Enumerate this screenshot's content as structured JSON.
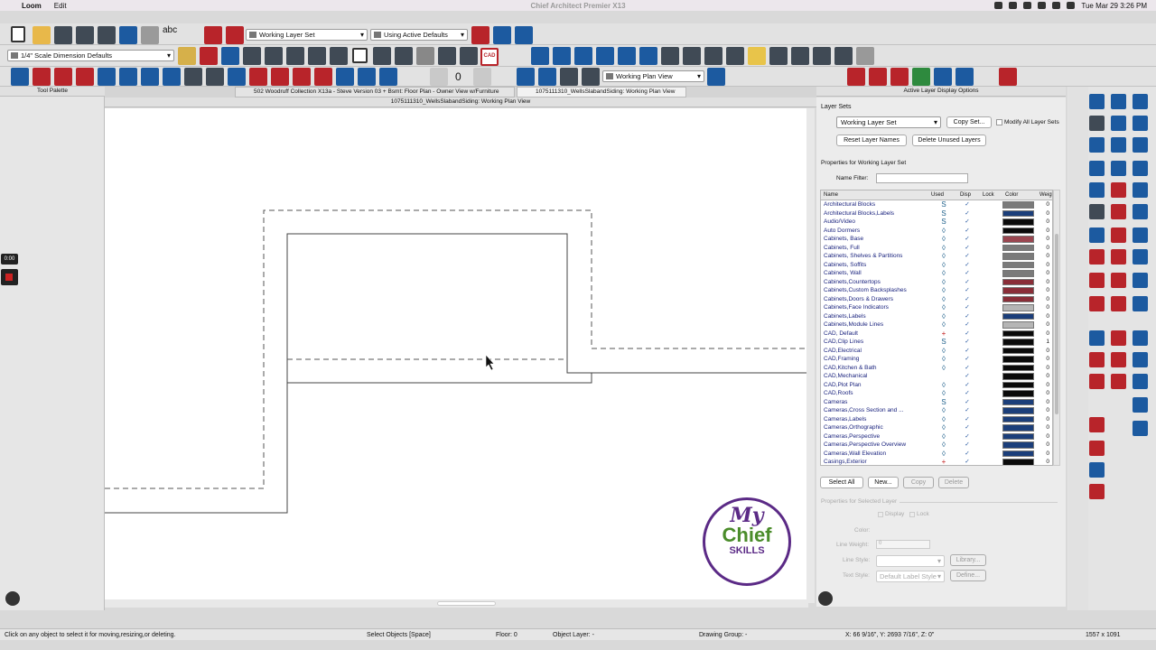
{
  "mac_menu": {
    "app": "Loom",
    "edit": "Edit",
    "window_title": "Chief Architect Premier X13",
    "datetime": "Tue Mar 29  3:26 PM"
  },
  "toolbar1": {
    "layer_set": "Working Layer Set",
    "defaults": "Using Active Defaults",
    "abc": "abc"
  },
  "toolbar2": {
    "dimension_defaults": "1/4\" Scale Dimension Defaults",
    "cad_label": "CAD"
  },
  "toolbar3": {
    "counter": "0",
    "plan_view": "Working Plan View"
  },
  "tabs": {
    "tool_palette": "Tool Palette",
    "tab1": "502 Woodruff Collection X13a - Steve Version 03 + Bsmt: Floor Plan - Owner View w/Furniture",
    "tab2": "1075111310_WellsSlabandSiding:  Working Plan View",
    "doc_title": "1075111310_WellsSlabandSiding:  Working Plan View",
    "ldp_title": "Active Layer Display Options"
  },
  "recorder": {
    "time": "0:00"
  },
  "ldp": {
    "layer_sets_label": "Layer Sets",
    "layer_set_value": "Working Layer Set",
    "copy_set": "Copy Set...",
    "modify_all": "Modify All Layer Sets",
    "reset_names": "Reset Layer Names",
    "delete_unused": "Delete Unused Layers",
    "properties_for": "Properties for  Working Layer Set",
    "name_filter": "Name Filter:",
    "cols": {
      "name": "Name",
      "used": "Used",
      "disp": "Disp",
      "lock": "Lock",
      "color": "Color",
      "weight": "Weigh"
    },
    "layers": [
      {
        "name": "Architectural Blocks",
        "used": "S",
        "color": "#7a7a7a",
        "weight": "0"
      },
      {
        "name": "Architectural Blocks,Labels",
        "used": "S",
        "color": "#1b3e7a",
        "weight": "0"
      },
      {
        "name": "Audio/Video",
        "used": "S",
        "color": "#0a0a0a",
        "weight": "0"
      },
      {
        "name": "Auto Dormers",
        "used": "◊",
        "color": "#0a0a0a",
        "weight": "0"
      },
      {
        "name": "Cabinets, Base",
        "used": "◊",
        "color": "#9a4650",
        "weight": "0"
      },
      {
        "name": "Cabinets, Full",
        "used": "◊",
        "color": "#7a7a7a",
        "weight": "0"
      },
      {
        "name": "Cabinets, Shelves & Partitions",
        "used": "◊",
        "color": "#7a7a7a",
        "weight": "0"
      },
      {
        "name": "Cabinets, Soffits",
        "used": "◊",
        "color": "#7a7a7a",
        "weight": "0"
      },
      {
        "name": "Cabinets, Wall",
        "used": "◊",
        "color": "#7a7a7a",
        "weight": "0"
      },
      {
        "name": "Cabinets,Countertops",
        "used": "◊",
        "color": "#8a2e38",
        "weight": "0"
      },
      {
        "name": "Cabinets,Custom Backsplashes",
        "used": "◊",
        "color": "#8a2e38",
        "weight": "0"
      },
      {
        "name": "Cabinets,Doors & Drawers",
        "used": "◊",
        "color": "#8a2e38",
        "weight": "0"
      },
      {
        "name": "Cabinets,Face Indicators",
        "used": "◊",
        "color": "#b5b5b5",
        "weight": "0"
      },
      {
        "name": "Cabinets,Labels",
        "used": "◊",
        "color": "#1b3e7a",
        "weight": "0"
      },
      {
        "name": "Cabinets,Module Lines",
        "used": "◊",
        "color": "#b5b5b5",
        "weight": "0"
      },
      {
        "name": "CAD, Default",
        "used": "+",
        "color": "#0a0a0a",
        "weight": "0"
      },
      {
        "name": "CAD,Clip Lines",
        "used": "S",
        "color": "#0a0a0a",
        "weight": "1"
      },
      {
        "name": "CAD,Electrical",
        "used": "◊",
        "color": "#0a0a0a",
        "weight": "0"
      },
      {
        "name": "CAD,Framing",
        "used": "◊",
        "color": "#0a0a0a",
        "weight": "0"
      },
      {
        "name": "CAD,Kitchen & Bath",
        "used": "◊",
        "color": "#0a0a0a",
        "weight": "0"
      },
      {
        "name": "CAD,Mechanical",
        "used": "",
        "color": "#0a0a0a",
        "weight": "0"
      },
      {
        "name": "CAD,Plot Plan",
        "used": "◊",
        "color": "#0a0a0a",
        "weight": "0"
      },
      {
        "name": "CAD,Roofs",
        "used": "◊",
        "color": "#0a0a0a",
        "weight": "0"
      },
      {
        "name": "Cameras",
        "used": "S",
        "color": "#1b3e7a",
        "weight": "0"
      },
      {
        "name": "Cameras,Cross Section and ...",
        "used": "◊",
        "color": "#1b3e7a",
        "weight": "0"
      },
      {
        "name": "Cameras,Labels",
        "used": "◊",
        "color": "#1b3e7a",
        "weight": "0"
      },
      {
        "name": "Cameras,Orthographic",
        "used": "◊",
        "color": "#1b3e7a",
        "weight": "0"
      },
      {
        "name": "Cameras,Perspective",
        "used": "◊",
        "color": "#1b3e7a",
        "weight": "0"
      },
      {
        "name": "Cameras,Perspective Overview",
        "used": "◊",
        "color": "#1b3e7a",
        "weight": "0"
      },
      {
        "name": "Cameras,Wall Elevation",
        "used": "◊",
        "color": "#1b3e7a",
        "weight": "0"
      },
      {
        "name": "Casings,Exterior",
        "used": "+",
        "color": "#0a0a0a",
        "weight": "0"
      }
    ],
    "select_all": "Select All",
    "new": "New...",
    "copy": "Copy",
    "delete": "Delete",
    "props_selected": "Properties for Selected Layer",
    "display": "Display",
    "lock": "Lock",
    "color": "Color:",
    "line_weight": "Line Weight:",
    "line_weight_value": "0",
    "line_style": "Line Style:",
    "library": "Library...",
    "text_style": "Text Style:",
    "text_style_value": "Default Label Style",
    "define": "Define..."
  },
  "logo": {
    "my": "My",
    "chief": "Chief",
    "skills": "SKILLS"
  },
  "status": {
    "hint": "Click on any object to select it for moving,resizing,or deleting.",
    "mode": "Select Objects [Space]",
    "floor": "Floor: 0",
    "layer": "Object Layer: -",
    "group": "Drawing Group: -",
    "coords": "X: 66 9/16\", Y: 2693 7/16\", Z: 0\"",
    "size": "1557 x 1091"
  },
  "colors": {
    "accent_blue": "#1c5aa0",
    "accent_red": "#b8242a",
    "logo_purple": "#5b2a86",
    "logo_green": "#4a8c2a"
  }
}
